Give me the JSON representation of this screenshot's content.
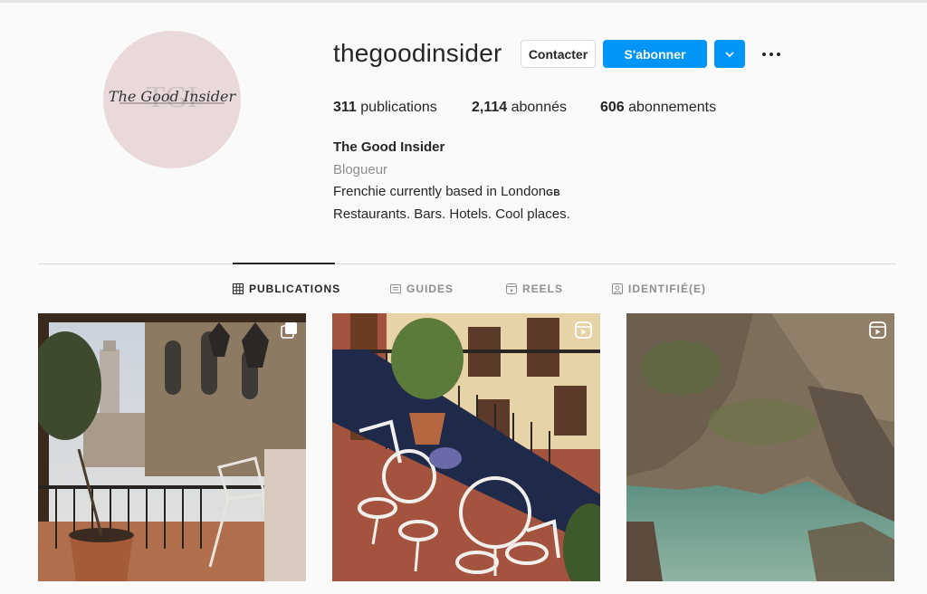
{
  "profile": {
    "username": "thegoodinsider",
    "avatar_text": "The Good Insider",
    "avatar_monogram": "TGI",
    "buttons": {
      "contact": "Contacter",
      "follow": "S'abonner"
    },
    "stats": {
      "posts_count": "311",
      "posts_label": "publications",
      "followers_count": "2,114",
      "followers_label": "abonnés",
      "following_count": "606",
      "following_label": "abonnements"
    },
    "bio": {
      "name": "The Good Insider",
      "category": "Blogueur",
      "line1": "Frenchie currently based in London",
      "line1_flag": "GB",
      "line2": "Restaurants. Bars. Hotels. Cool places."
    }
  },
  "tabs": [
    {
      "label": "PUBLICATIONS",
      "icon": "grid-icon",
      "active": true
    },
    {
      "label": "GUIDES",
      "icon": "guide-icon",
      "active": false
    },
    {
      "label": "REELS",
      "icon": "reels-icon",
      "active": false
    },
    {
      "label": "IDENTIFIÉ(E)",
      "icon": "tagged-icon",
      "active": false
    }
  ],
  "posts": [
    {
      "scene": "Florence terrace with bell tower and potted plant",
      "badge": "carousel-icon"
    },
    {
      "scene": "Balcony with white wrought-iron chairs and table",
      "badge": "reels-icon"
    },
    {
      "scene": "Rocky cliff cove with turquoise water",
      "badge": "reels-icon"
    }
  ],
  "colors": {
    "accent": "#0095f6",
    "background": "#fafafa",
    "avatar_bg": "#e9d9da"
  }
}
